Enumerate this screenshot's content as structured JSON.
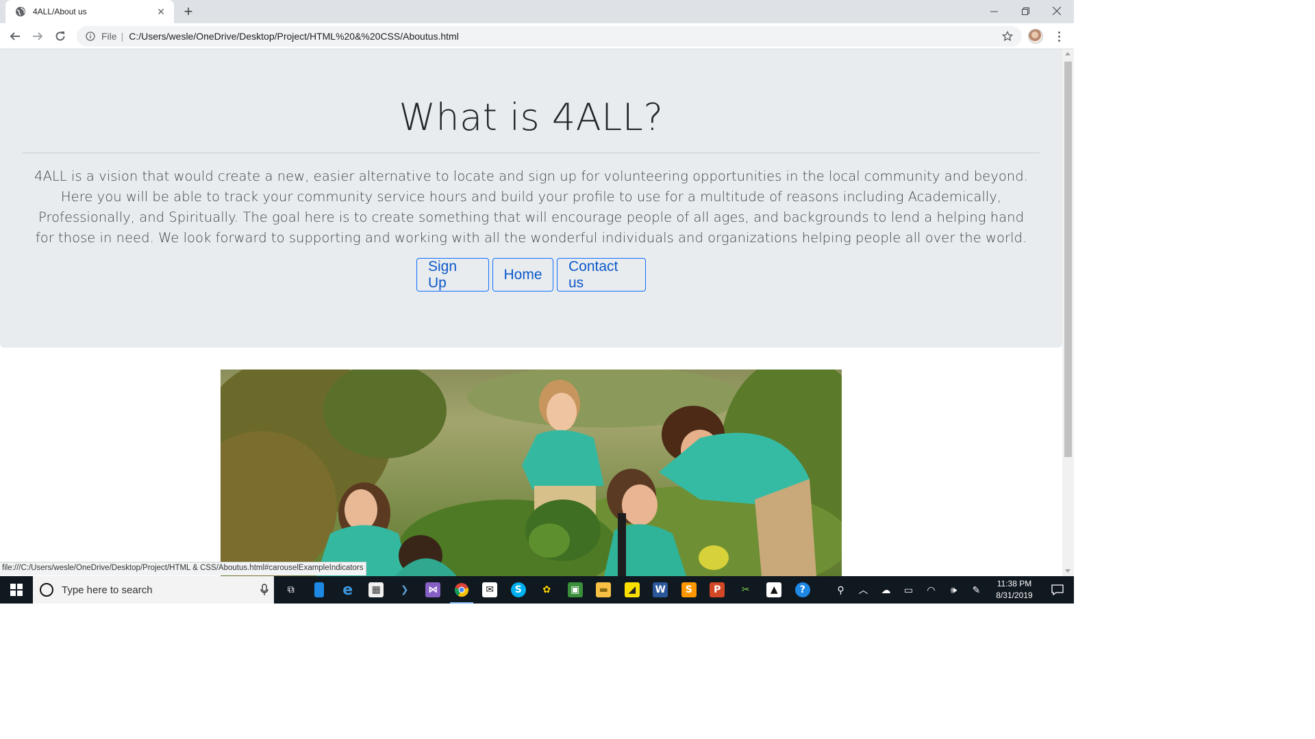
{
  "browser": {
    "tab_title": "4ALL/About us",
    "scheme_label": "File",
    "url": "C:/Users/wesle/OneDrive/Desktop/Project/HTML%20&%20CSS/Aboutus.html",
    "status_url": "file:///C:/Users/wesle/OneDrive/Desktop/Project/HTML & CSS/Aboutus.html#carouselExampleIndicators"
  },
  "page": {
    "heading": "What is 4ALL?",
    "lead": "4ALL is a vision that would create a new, easier alternative to locate and sign up for volunteering opportunities in the local community and beyond. Here you will be able to track your community service hours and build your profile to use for a multitude of reasons including Academically, Professionally, and Spiritually. The goal here is to create something that will encourage people of all ages, and backgrounds to lend a helping hand for those in need. We look forward to supporting and working with all the wonderful individuals and organizations helping people all over the world.",
    "buttons": {
      "signup": "Sign Up",
      "home": "Home",
      "contact": "Contact us"
    },
    "carousel_image": "volunteers-planting-photo"
  },
  "taskbar": {
    "search_placeholder": "Type here to search",
    "time": "11:38 PM",
    "date": "8/31/2019",
    "apps": [
      "task-view-icon",
      "file-icon",
      "edge-icon",
      "store-icon",
      "powershell-icon",
      "visual-studio-icon",
      "chrome-icon",
      "mail-icon",
      "skype-icon",
      "paint-icon",
      "camera-icon",
      "file-explorer-icon",
      "sticky-notes-icon",
      "word-icon",
      "sublime-icon",
      "powerpoint-icon",
      "snip-icon",
      "photos-icon",
      "help-icon"
    ]
  },
  "colors": {
    "jumbotron_bg": "#e9ecef",
    "button_border": "#0d6efd",
    "button_text": "#0a58ca",
    "taskbar_bg": "#101820"
  }
}
